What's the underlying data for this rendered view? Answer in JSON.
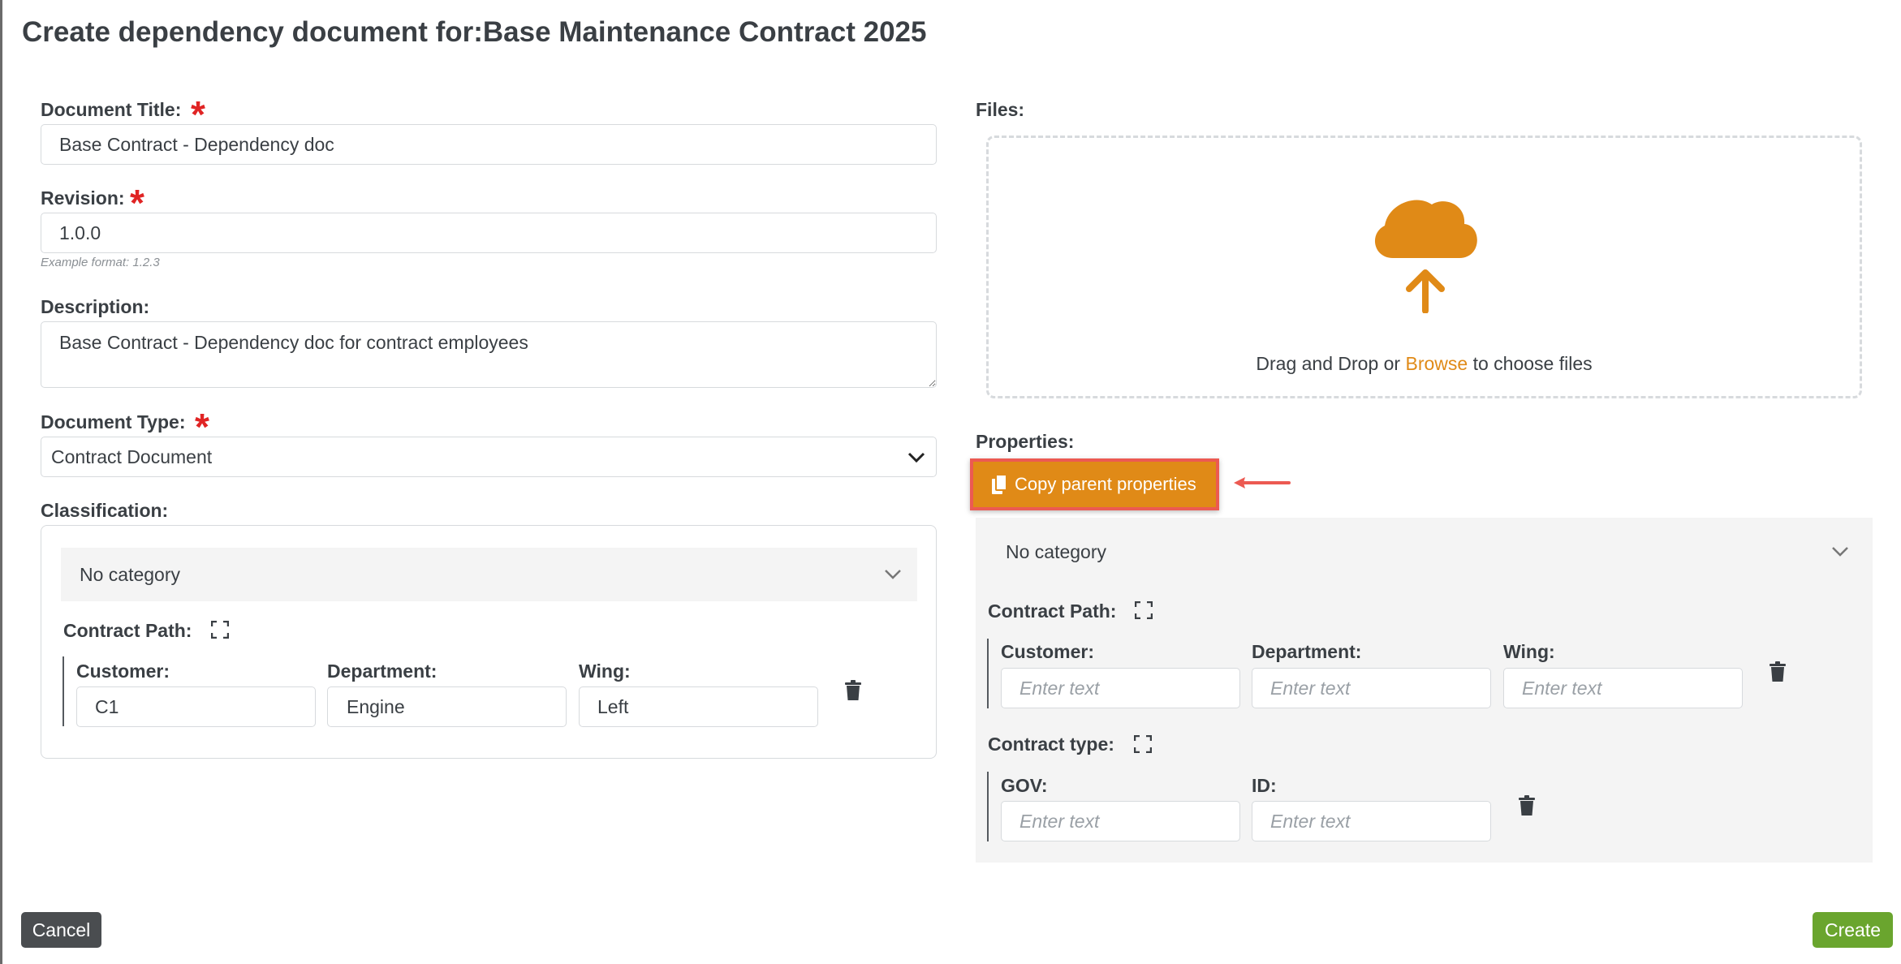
{
  "page": {
    "title": "Create dependency document for:Base Maintenance Contract 2025"
  },
  "form": {
    "document_title": {
      "label": "Document Title:",
      "value": "Base Contract - Dependency doc",
      "required": true
    },
    "revision": {
      "label": "Revision:",
      "value": "1.0.0",
      "hint": "Example format: 1.2.3",
      "required": true
    },
    "description": {
      "label": "Description:",
      "value": "Base Contract - Dependency doc for contract employees"
    },
    "document_type": {
      "label": "Document Type:",
      "value": "Contract Document",
      "required": true
    },
    "classification": {
      "label": "Classification:",
      "category": "No category",
      "contract_path": {
        "title": "Contract Path:",
        "fields": [
          {
            "label": "Customer:",
            "value": "C1"
          },
          {
            "label": "Department:",
            "value": "Engine"
          },
          {
            "label": "Wing:",
            "value": "Left"
          }
        ]
      }
    }
  },
  "files": {
    "label": "Files:",
    "drop_text_before": "Drag and Drop or ",
    "browse_label": "Browse",
    "drop_text_after": " to choose files"
  },
  "properties": {
    "label": "Properties:",
    "copy_button_label": "Copy parent properties",
    "category": "No category",
    "contract_path": {
      "title": "Contract Path:",
      "fields": [
        {
          "label": "Customer:",
          "placeholder": "Enter text"
        },
        {
          "label": "Department:",
          "placeholder": "Enter text"
        },
        {
          "label": "Wing:",
          "placeholder": "Enter text"
        }
      ]
    },
    "contract_type": {
      "title": "Contract type:",
      "fields": [
        {
          "label": "GOV:",
          "placeholder": "Enter text"
        },
        {
          "label": "ID:",
          "placeholder": "Enter text"
        }
      ]
    }
  },
  "footer": {
    "cancel_label": "Cancel",
    "create_label": "Create"
  },
  "colors": {
    "accent": "#e08a17",
    "required": "#e02424",
    "highlight_border": "#ec5a52",
    "cancel_bg": "#4a4d50",
    "create_bg": "#6aa52e"
  }
}
